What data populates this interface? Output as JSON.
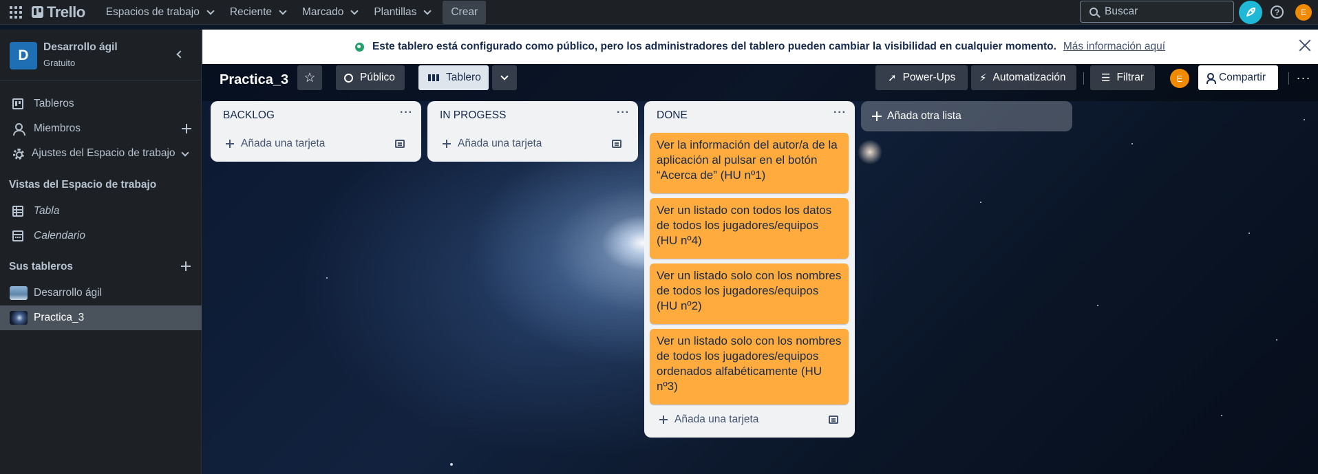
{
  "topnav": {
    "logo": "Trello",
    "items": [
      {
        "label": "Espacios de trabajo"
      },
      {
        "label": "Reciente"
      },
      {
        "label": "Marcado"
      },
      {
        "label": "Plantillas"
      }
    ],
    "create_label": "Crear",
    "search_placeholder": "Buscar",
    "avatar_initial": "E"
  },
  "sidebar": {
    "workspace_initial": "D",
    "workspace_name": "Desarrollo ágil",
    "workspace_plan": "Gratuito",
    "nav": [
      {
        "label": "Tableros",
        "icon": "board-icon"
      },
      {
        "label": "Miembros",
        "icon": "person-icon"
      },
      {
        "label": "Ajustes del Espacio de trabajo",
        "icon": "gear-icon"
      }
    ],
    "views_heading": "Vistas del Espacio de trabajo",
    "views": [
      {
        "label": "Tabla",
        "icon": "table-icon"
      },
      {
        "label": "Calendario",
        "icon": "calendar-icon"
      }
    ],
    "boards_heading": "Sus tableros",
    "boards": [
      {
        "label": "Desarrollo ágil",
        "thumb_color": "#7fa7c9",
        "active": false
      },
      {
        "label": "Practica_3",
        "thumb_color": "#1f2d45",
        "active": true
      }
    ]
  },
  "banner": {
    "message": "Este tablero está configurado como público, pero los administradores del tablero pueden cambiar la visibilidad en cualquier momento.",
    "link": "Más información aquí"
  },
  "board": {
    "title": "Practica_3",
    "visibility_label": "Público",
    "view_label": "Tablero",
    "powerups_label": "Power-Ups",
    "automation_label": "Automatización",
    "filter_label": "Filtrar",
    "avatar_initial": "E",
    "share_label": "Compartir",
    "add_list_label": "Añada otra lista"
  },
  "lists": [
    {
      "title": "BACKLOG",
      "add_card_label": "Añada una tarjeta",
      "cards": []
    },
    {
      "title": "IN PROGESS",
      "add_card_label": "Añada una tarjeta",
      "cards": []
    },
    {
      "title": "DONE",
      "add_card_label": "Añada una tarjeta",
      "cards": [
        {
          "text": "Ver la información del autor/a de la aplicación al pulsar en el botón “Acerca de” (HU nº1)"
        },
        {
          "text": "Ver un listado con todos los datos de todos los jugadores/equipos (HU nº4)"
        },
        {
          "text": "Ver un listado solo con los nombres de todos los jugadores/equipos (HU nº2)"
        },
        {
          "text": "Ver un listado solo con los nombres de todos los jugadores/equipos ordenados alfabéticamente (HU nº3)"
        }
      ]
    }
  ],
  "colors": {
    "nav_bg": "#1d2125",
    "card_bg": "#ffab3d",
    "list_bg": "#f1f2f4",
    "accent_cyan": "#1fb8d6",
    "avatar_orange": "#f08a00"
  }
}
